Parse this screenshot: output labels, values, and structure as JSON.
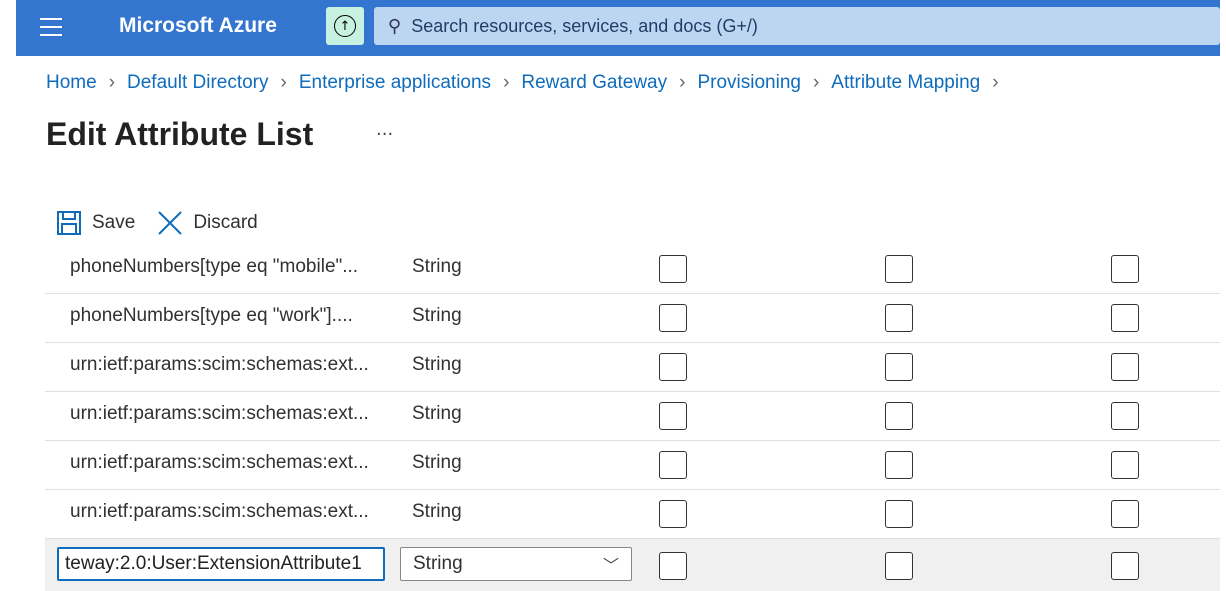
{
  "header": {
    "title": "Microsoft Azure",
    "search_placeholder": "Search resources, services, and docs (G+/)"
  },
  "breadcrumb": [
    "Home",
    "Default Directory",
    "Enterprise applications",
    "Reward Gateway",
    "Provisioning",
    "Attribute Mapping"
  ],
  "page": {
    "title": "Edit Attribute List",
    "more": "···"
  },
  "toolbar": {
    "save": "Save",
    "discard": "Discard"
  },
  "rows": [
    {
      "name": "phoneNumbers[type eq \"mobile\"...",
      "type": "String"
    },
    {
      "name": "phoneNumbers[type eq \"work\"]....",
      "type": "String"
    },
    {
      "name": "urn:ietf:params:scim:schemas:ext...",
      "type": "String"
    },
    {
      "name": "urn:ietf:params:scim:schemas:ext...",
      "type": "String"
    },
    {
      "name": "urn:ietf:params:scim:schemas:ext...",
      "type": "String"
    },
    {
      "name": "urn:ietf:params:scim:schemas:ext...",
      "type": "String"
    }
  ],
  "new_row": {
    "name_value": "teway:2.0:User:ExtensionAttribute1",
    "type_value": "String"
  }
}
